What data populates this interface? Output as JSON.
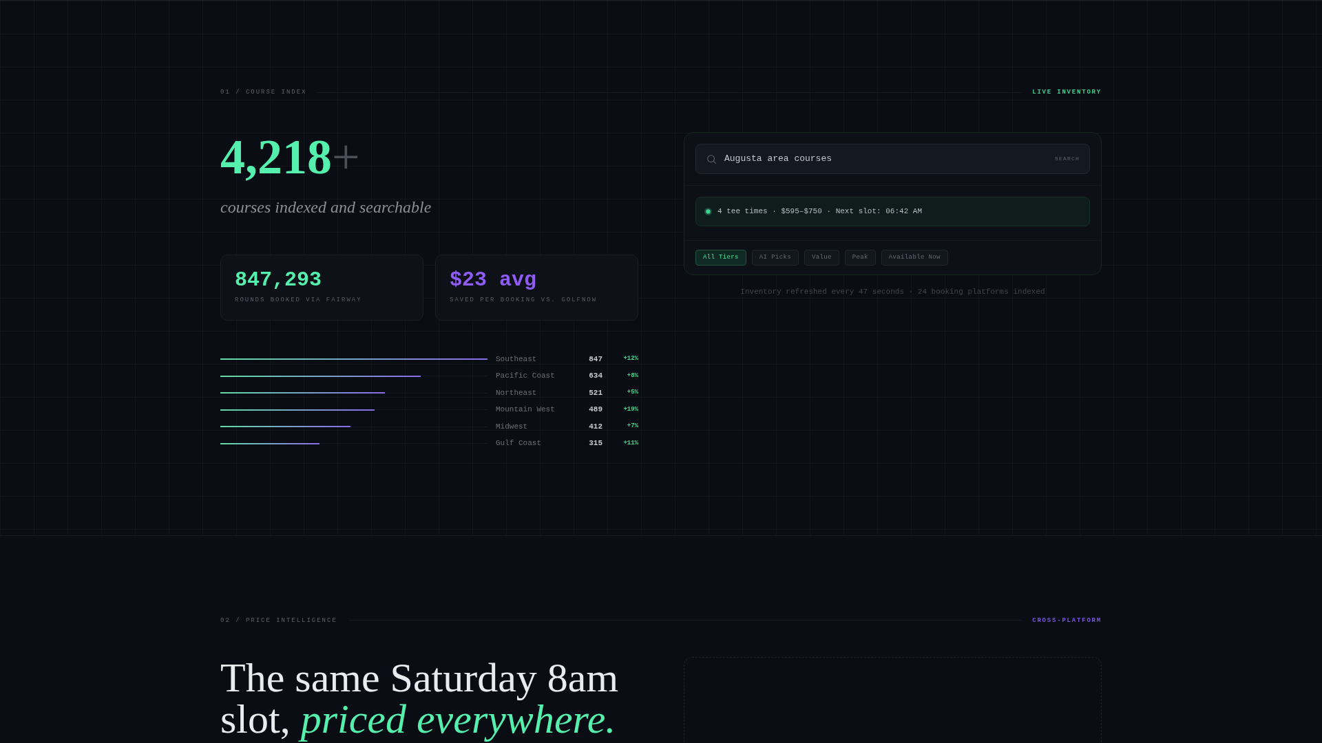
{
  "course_index": {
    "section_label": "01 / COURSE INDEX",
    "tag": "LIVE INVENTORY",
    "count": {
      "value": "4,218",
      "suffix": "+"
    },
    "caption": "courses indexed and searchable",
    "stats": [
      {
        "value": "847,293",
        "label": "ROUNDS BOOKED VIA FAIRWAY",
        "color": "#56f0ae"
      },
      {
        "value": "$23 avg",
        "label": "SAVED PER BOOKING VS. GOLFNOW",
        "color": "#8f5cf6"
      }
    ],
    "regions": [
      {
        "name": "Southeast",
        "count": "847",
        "change": "+12%",
        "level": 1.0
      },
      {
        "name": "Pacific Coast",
        "count": "634",
        "change": "+8%",
        "level": 0.749
      },
      {
        "name": "Northeast",
        "count": "521",
        "change": "+5%",
        "level": 0.615
      },
      {
        "name": "Mountain West",
        "count": "489",
        "change": "+19%",
        "level": 0.577
      },
      {
        "name": "Midwest",
        "count": "412",
        "change": "+7%",
        "level": 0.486
      },
      {
        "name": "Gulf Coast",
        "count": "315",
        "change": "+11%",
        "level": 0.372
      }
    ],
    "search": {
      "value": "Augusta area courses",
      "button": "SEARCH"
    },
    "result": "4 tee times · $595–$750 · Next slot: 06:42 AM",
    "filters": [
      {
        "label": "All Tiers",
        "selected": true
      },
      {
        "label": "AI Picks",
        "selected": false
      },
      {
        "label": "Value",
        "selected": false
      },
      {
        "label": "Peak",
        "selected": false
      },
      {
        "label": "Available Now",
        "selected": false
      }
    ],
    "footnote": "Inventory refreshed every 47 seconds · 24 booking platforms indexed"
  },
  "price_intelligence": {
    "section_label": "02 / PRICE INTELLIGENCE",
    "tag": "CROSS-PLATFORM",
    "headline": "The same Saturday 8am slot, *priced everywhere.*"
  }
}
